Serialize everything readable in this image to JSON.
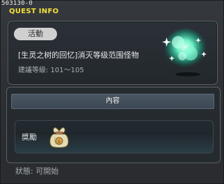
{
  "window": {
    "quest_id": "503130-0",
    "title": "QUEST INFO"
  },
  "quest": {
    "tag": "活動",
    "name": "[生灵之树的回忆]消灭等级范围怪物",
    "level_label": "建議等級: 101～105"
  },
  "content": {
    "header": "內容",
    "reward_label": "獎勵",
    "reward_icon": "coin-bag-icon"
  },
  "status": {
    "text": "狀態: 可開始"
  }
}
